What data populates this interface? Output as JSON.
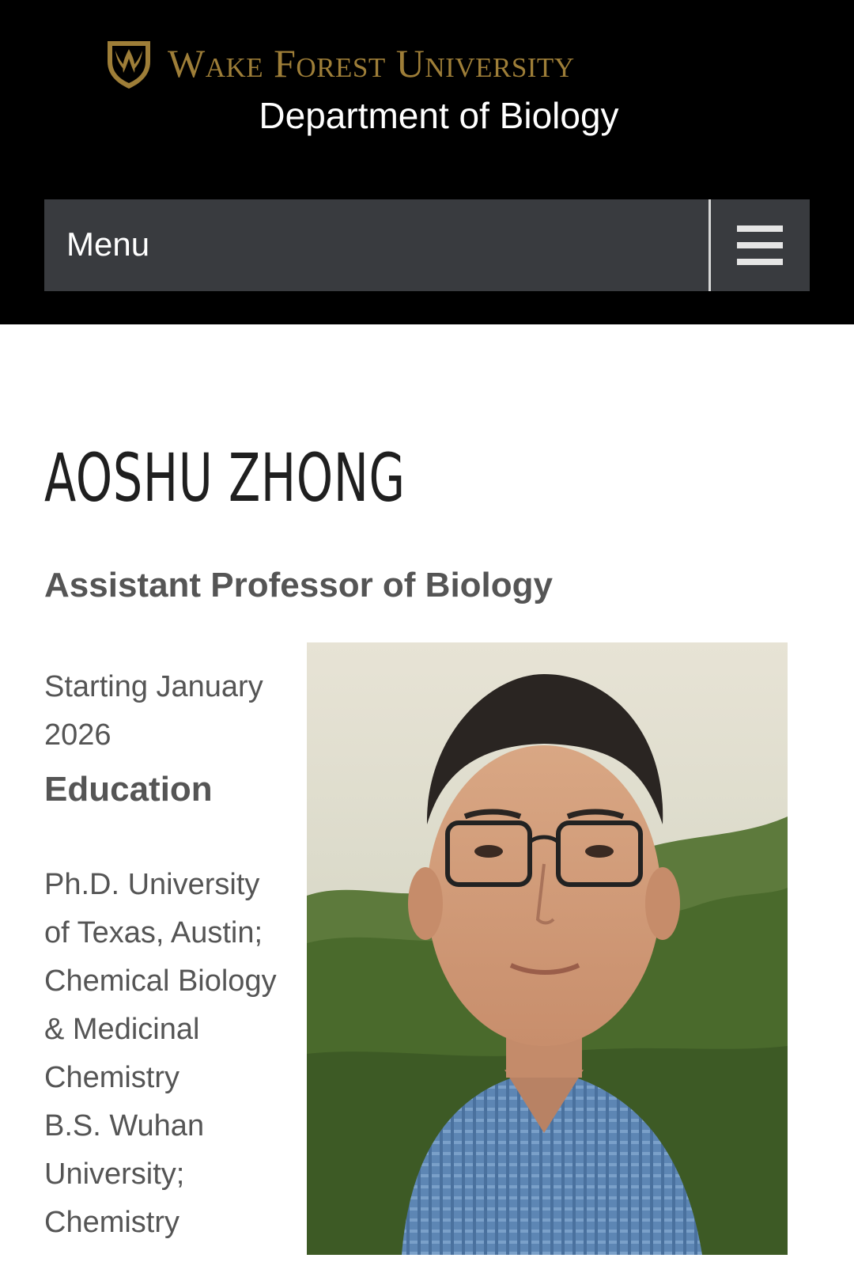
{
  "header": {
    "university": "Wake Forest University",
    "department": "Department of Biology",
    "logo_icon": "shield-crest-icon"
  },
  "nav": {
    "menu_label": "Menu",
    "toggle_icon": "hamburger-icon"
  },
  "profile": {
    "name": "AOSHU ZHONG",
    "title": "Assistant Professor of Biology",
    "start_lines": [
      "Starting January",
      "2026"
    ],
    "education_heading": "Education",
    "education_lines": [
      "Ph.D. University",
      "of Texas, Austin;",
      "Chemical Biology",
      "& Medicinal",
      "Chemistry",
      "B.S. Wuhan",
      "University;",
      "Chemistry"
    ]
  },
  "colors": {
    "header_bg": "#000000",
    "brand_gold": "#9e7e38",
    "menu_bg": "#393b3f",
    "heading_dark": "#1f1f1f",
    "body_text": "#555555"
  }
}
